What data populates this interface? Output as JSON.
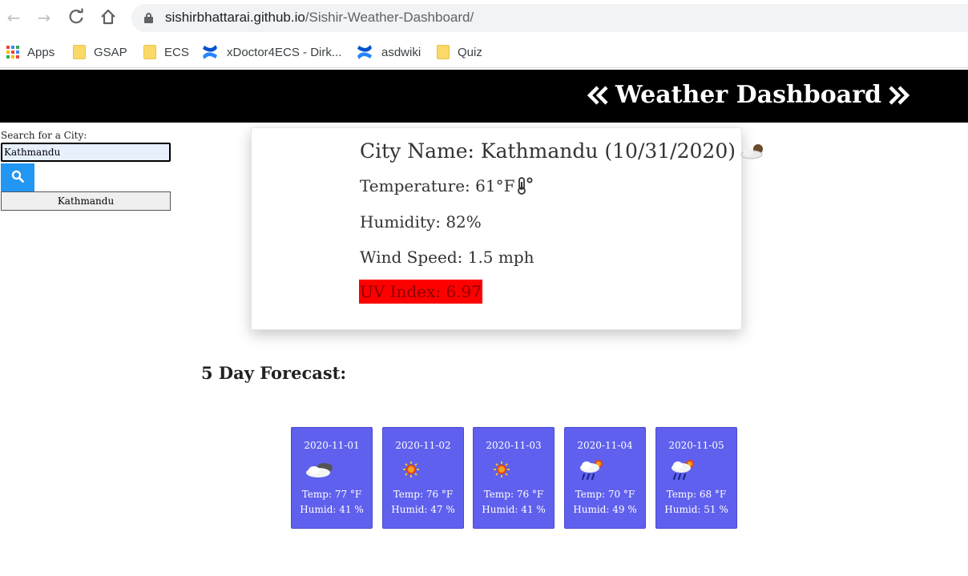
{
  "browser": {
    "url_host": "sishirbhattarai.github.io",
    "url_path": "/Sishir-Weather-Dashboard/",
    "bookmarks": [
      {
        "label": "Apps",
        "icon": "apps-grid-icon"
      },
      {
        "label": "GSAP",
        "icon": "folder-icon"
      },
      {
        "label": "ECS",
        "icon": "folder-icon"
      },
      {
        "label": "xDoctor4ECS - Dirk...",
        "icon": "confluence-icon"
      },
      {
        "label": "asdwiki",
        "icon": "confluence-icon"
      },
      {
        "label": "Quiz",
        "icon": "folder-icon"
      }
    ]
  },
  "header": {
    "title": "Weather Dashboard"
  },
  "search": {
    "label": "Search for a City:",
    "value": "Kathmandu",
    "history": [
      "Kathmandu"
    ]
  },
  "current": {
    "city_line": "City Name: Kathmandu (10/31/2020)",
    "temperature": "Temperature: 61°F",
    "humidity": "Humidity: 82%",
    "wind": "Wind Speed: 1.5 mph",
    "uv": "UV Index: 6.97",
    "uv_color": "#ff0000",
    "icon": "partly-cloudy-icon"
  },
  "forecast": {
    "title": "5 Day Forecast:",
    "days": [
      {
        "date": "2020-11-01",
        "icon": "cloudy-night-icon",
        "temp": "Temp: 77 °F",
        "humid": "Humid: 41 %"
      },
      {
        "date": "2020-11-02",
        "icon": "sun-icon",
        "temp": "Temp: 76 °F",
        "humid": "Humid: 47 %"
      },
      {
        "date": "2020-11-03",
        "icon": "sun-icon",
        "temp": "Temp: 76 °F",
        "humid": "Humid: 41 %"
      },
      {
        "date": "2020-11-04",
        "icon": "rain-sun-icon",
        "temp": "Temp: 70 °F",
        "humid": "Humid: 49 %"
      },
      {
        "date": "2020-11-05",
        "icon": "rain-sun-icon",
        "temp": "Temp: 68 °F",
        "humid": "Humid: 51 %"
      }
    ]
  },
  "colors": {
    "header_bg": "#000000",
    "card_bg": "#6060ee",
    "search_button": "#2196f3"
  }
}
